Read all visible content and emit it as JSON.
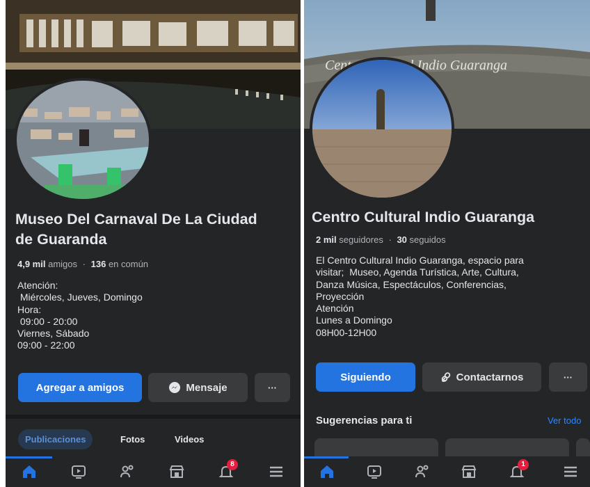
{
  "colors": {
    "background": "#242526",
    "primary_button": "#2374e1",
    "secondary_button": "#3a3b3c",
    "text": "#e4e6eb",
    "muted_text": "#b0b3b8",
    "badge": "#e41e3f",
    "link": "#2d88ff"
  },
  "left": {
    "profile_name_line1": "Museo Del Carnaval De La Ciudad",
    "profile_name_line2": "de Guaranda",
    "friends_count": "4,9 mil",
    "friends_label": "amigos",
    "separator": "·",
    "mutual_count": "136",
    "mutual_label": "en común",
    "bio_lines": [
      "Atención:",
      " Miércoles, Jueves, Domingo",
      "Hora:",
      " 09:00 - 20:00",
      "Viernes, Sábado",
      "09:00 - 22:00"
    ],
    "add_friend_label": "Agregar a amigos",
    "message_label": "Mensaje",
    "more_label": "···",
    "tabs": [
      "Publicaciones",
      "Fotos",
      "Videos"
    ],
    "notification_count": "8",
    "nav_icons": [
      "home-icon",
      "watch-icon",
      "friends-icon",
      "marketplace-icon",
      "notifications-icon",
      "menu-icon"
    ]
  },
  "right": {
    "profile_name": "Centro Cultural Indio Guaranga",
    "cover_text": "Centro Cultural Indio Guaranga",
    "followers_count": "2 mil",
    "followers_label": "seguidores",
    "separator": "·",
    "following_count": "30",
    "following_label": "seguidos",
    "bio_lines": [
      "El Centro Cultural Indio Guaranga, espacio para",
      "visitar;  Museo, Agenda Turística, Arte, Cultura,",
      "Danza Música, Espectáculos, Conferencias,",
      "Proyección",
      "Atención",
      "Lunes a Domingo",
      "08H00-12H00"
    ],
    "following_button_label": "Siguiendo",
    "contact_button_label": "Contactarnos",
    "more_label": "···",
    "suggestions_title": "Sugerencias para ti",
    "see_all_label": "Ver todo",
    "notification_count": "1",
    "nav_icons": [
      "home-icon",
      "watch-icon",
      "friends-icon",
      "marketplace-icon",
      "notifications-icon",
      "menu-icon"
    ]
  }
}
